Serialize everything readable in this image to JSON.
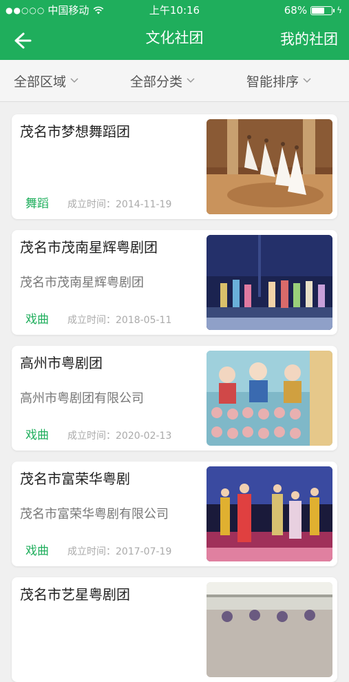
{
  "status_bar": {
    "signal": "●●○○○",
    "carrier": "中国移动",
    "time": "上午10:16",
    "battery": "68%",
    "battery_level": 0.68
  },
  "header": {
    "title": "文化社团",
    "right_action": "我的社团"
  },
  "filters": [
    "全部区域",
    "全部分类",
    "智能排序"
  ],
  "cards": [
    {
      "name": "茂名市梦想舞蹈团",
      "subtitle": "",
      "category": "舞蹈",
      "founded": "成立时间：2014-11-19"
    },
    {
      "name": "茂名市茂南星辉粤剧团",
      "subtitle": "茂名市茂南星辉粤剧团",
      "category": "戏曲",
      "founded": "成立时间：2018-05-11"
    },
    {
      "name": "高州市粤剧团",
      "subtitle": "高州市粤剧团有限公司",
      "category": "戏曲",
      "founded": "成立时间：2020-02-13"
    },
    {
      "name": "茂名市富荣华粤剧",
      "subtitle": "茂名市富荣华粤剧有限公司",
      "category": "戏曲",
      "founded": "成立时间：2017-07-19"
    },
    {
      "name": "茂名市艺星粤剧团",
      "subtitle": "",
      "category": "",
      "founded": ""
    }
  ],
  "colors": {
    "accent": "#1fae5c",
    "background": "#f0f0f0"
  }
}
